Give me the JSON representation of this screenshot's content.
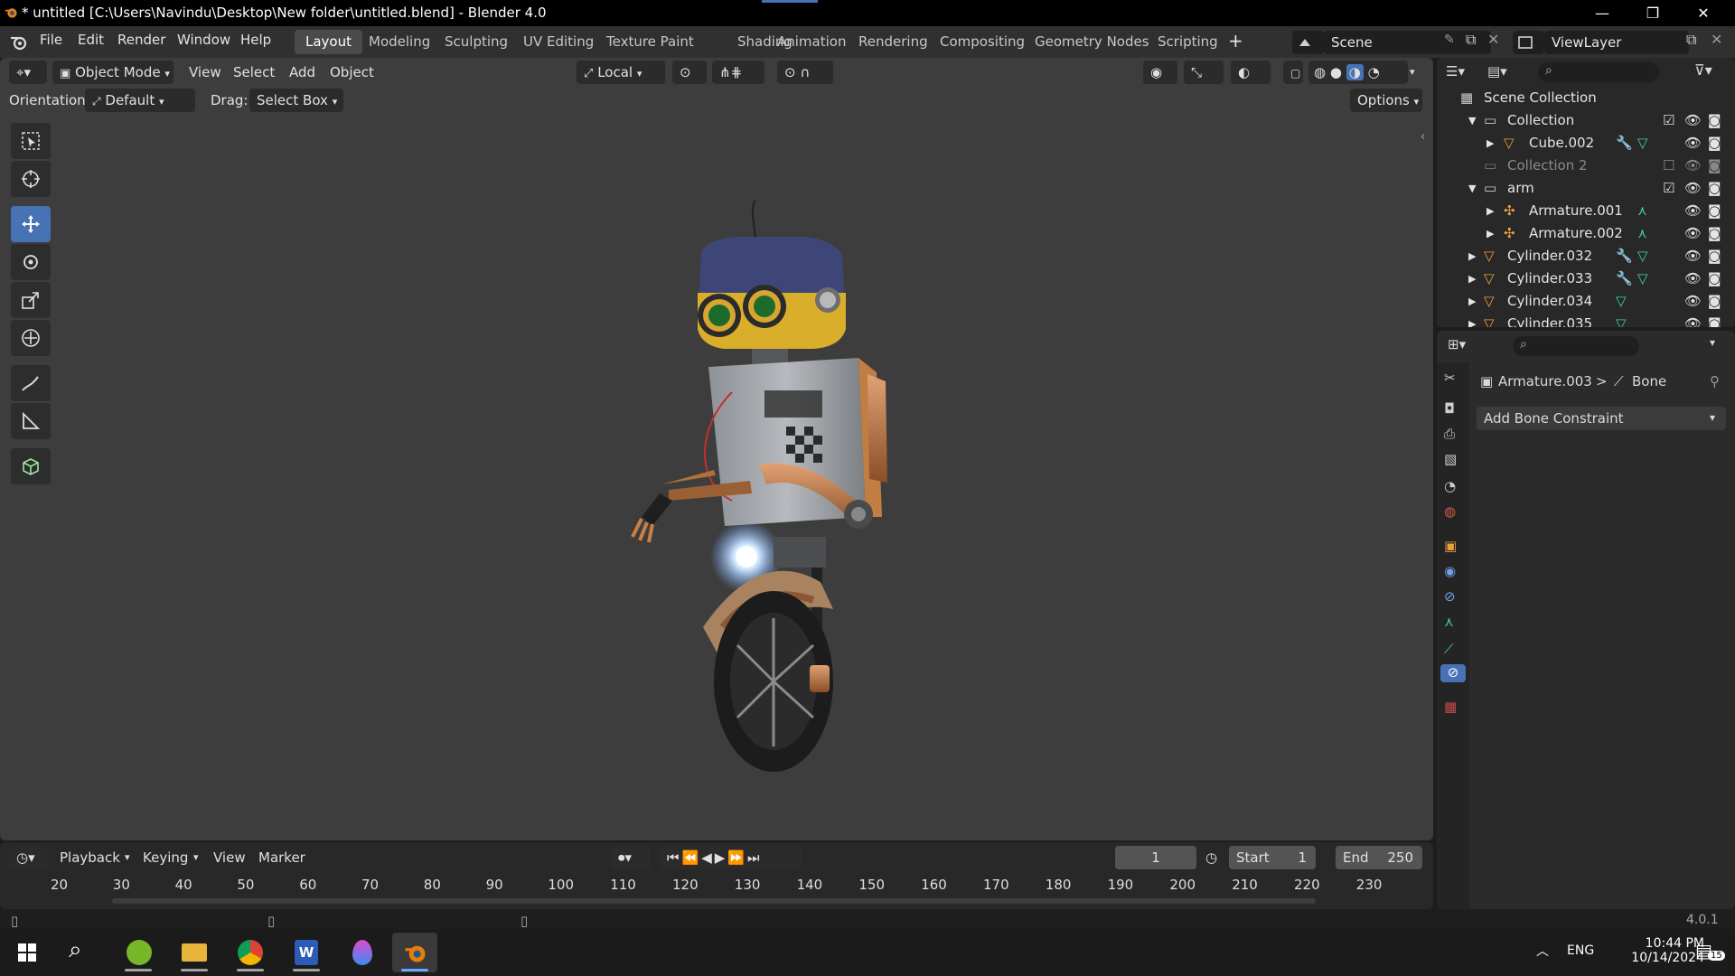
{
  "window": {
    "title": "* untitled [C:\\Users\\Navindu\\Desktop\\New folder\\untitled.blend] - Blender 4.0",
    "minimize": "—",
    "maximize": "❐",
    "close": "✕"
  },
  "menu": [
    "File",
    "Edit",
    "Render",
    "Window",
    "Help"
  ],
  "workspaces": [
    "Layout",
    "Modeling",
    "Sculpting",
    "UV Editing",
    "Texture Paint",
    "Shading",
    "Animation",
    "Rendering",
    "Compositing",
    "Geometry Nodes",
    "Scripting"
  ],
  "active_workspace": "Layout",
  "scene": {
    "label": "Scene"
  },
  "viewlayer": {
    "label": "ViewLayer"
  },
  "viewport_header": {
    "mode": "Object Mode",
    "menus": [
      "View",
      "Select",
      "Add",
      "Object"
    ],
    "transform_orientation": "Local"
  },
  "tool_settings": {
    "orientation_label": "Orientation:",
    "orientation_value": "Default",
    "drag_label": "Drag:",
    "drag_value": "Select Box",
    "options": "Options"
  },
  "outliner": {
    "rows": [
      {
        "label": "Scene Collection"
      },
      {
        "label": "Collection"
      },
      {
        "label": "Cube.002"
      },
      {
        "label": "Collection 2"
      },
      {
        "label": "arm"
      },
      {
        "label": "Armature.001"
      },
      {
        "label": "Armature.002"
      },
      {
        "label": "Cylinder.032"
      },
      {
        "label": "Cylinder.033"
      },
      {
        "label": "Cylinder.034"
      },
      {
        "label": "Cylinder.035"
      }
    ]
  },
  "properties": {
    "breadcrumb_object": "Armature.003",
    "breadcrumb_sep": ">",
    "breadcrumb_bone": "Bone",
    "add_constraint": "Add Bone Constraint"
  },
  "timeline": {
    "menus": [
      "Playback",
      "Keying",
      "View",
      "Marker"
    ],
    "current_frame": "1",
    "start_label": "Start",
    "start_value": "1",
    "end_label": "End",
    "end_value": "250",
    "ticks": [
      "20",
      "30",
      "40",
      "50",
      "60",
      "70",
      "80",
      "90",
      "100",
      "110",
      "120",
      "130",
      "140",
      "150",
      "160",
      "170",
      "180",
      "190",
      "200",
      "210",
      "220",
      "230"
    ]
  },
  "status": {
    "version": "4.0.1"
  },
  "taskbar": {
    "lang": "ENG",
    "time": "10:44 PM",
    "date": "10/14/2024",
    "notifications": "15"
  },
  "colors": {
    "accent_blue": "#4772b3",
    "active_tab": "#4a4a4a",
    "viewport_bg": "#3d3d3d",
    "mesh_icon": "#e9a03c",
    "armature_icon": "#e9a03c",
    "bone_green": "#3fd39f",
    "modifier_blue": "#6fa0e8"
  },
  "icons": {
    "blender_logo": "blender-icon",
    "search": "search-icon",
    "eye": "eye-icon",
    "camera": "camera-icon",
    "checkbox": "checkbox-icon"
  }
}
